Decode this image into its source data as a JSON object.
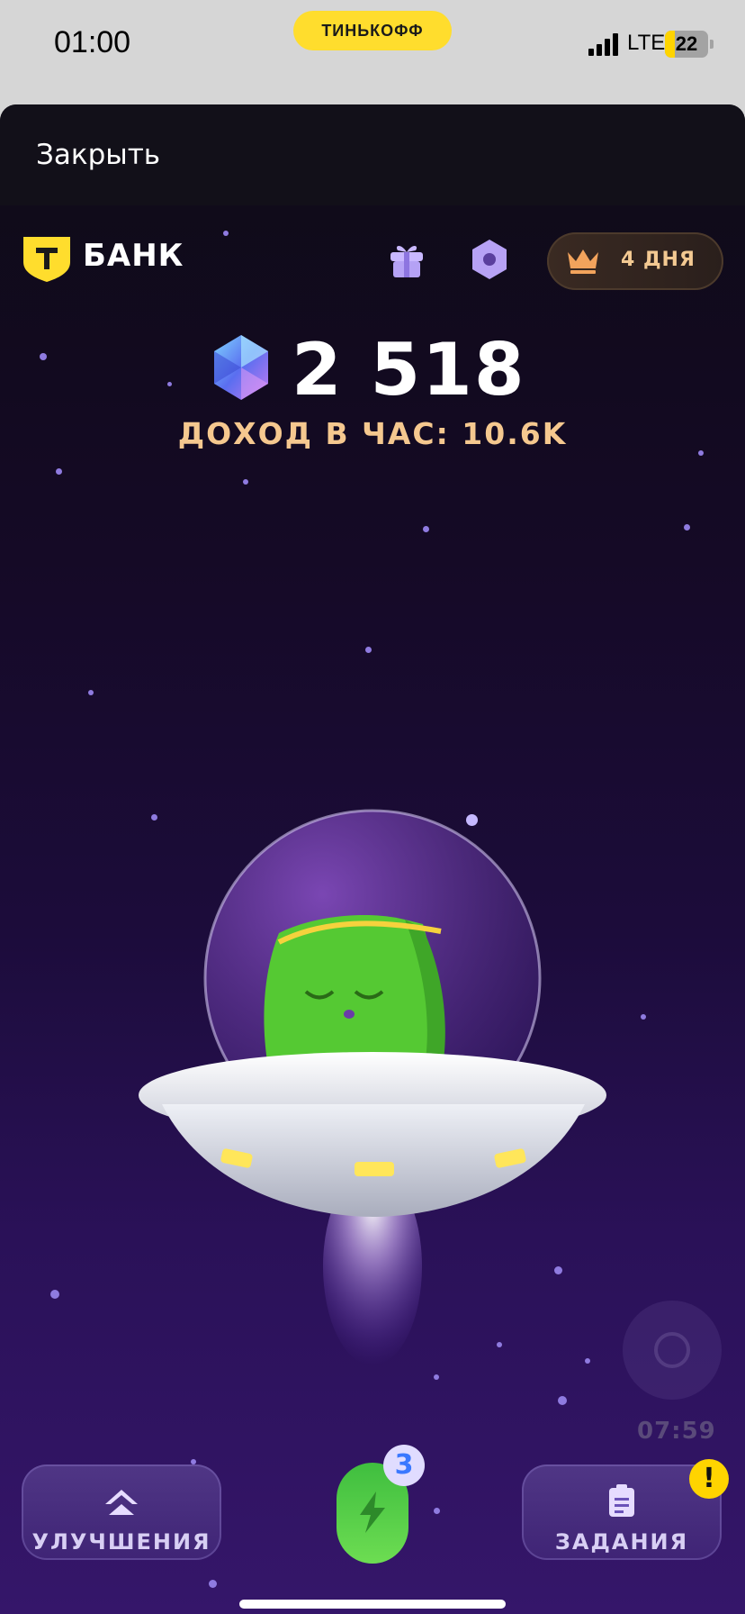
{
  "status_bar": {
    "time": "01:00",
    "carrier_pill": "ТИНЬКОФФ",
    "network": "LTE",
    "battery": "22"
  },
  "sheet": {
    "close_label": "Закрыть"
  },
  "header": {
    "logo_text": "БАНК",
    "streak_label": "4 ДНЯ"
  },
  "balance": {
    "score": "2 518",
    "income": "ДОХОД В ЧАС: 10.6K"
  },
  "timer": {
    "label": "07:59"
  },
  "bottom_nav": {
    "upgrades_label": "УЛУЧШЕНИЯ",
    "energy_badge": "3",
    "tasks_label": "ЗАДАНИЯ",
    "tasks_alert": "!"
  },
  "colors": {
    "accent_yellow": "#ffdd2d",
    "income_text": "#f5c88f",
    "energy_green": "#4fcf45",
    "background_top": "#0e0b16",
    "background_bottom": "#35166a"
  },
  "icons": [
    "gift-icon",
    "hexagon-icon",
    "crown-icon",
    "gem-icon",
    "chevron-up-icon",
    "lightning-icon",
    "clipboard-icon"
  ]
}
